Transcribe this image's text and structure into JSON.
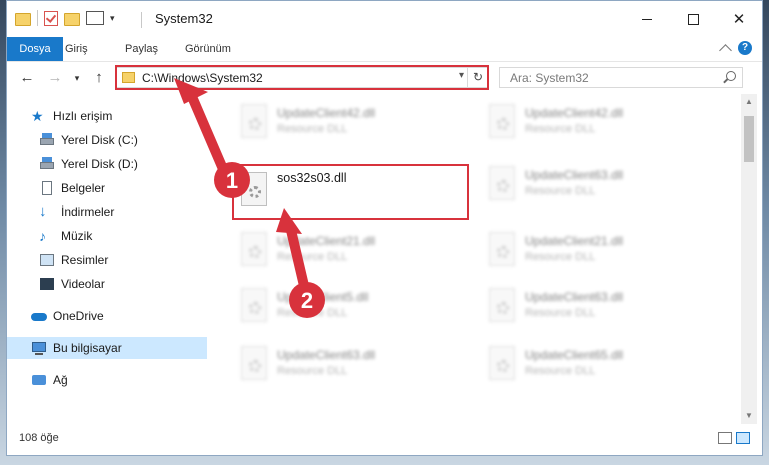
{
  "window": {
    "title": "System32",
    "controls": {
      "minimize": "minimize-icon",
      "maximize": "maximize-icon",
      "close": "✕"
    }
  },
  "ribbon": {
    "tabs": [
      "Dosya",
      "Giriş",
      "Paylaş",
      "Görünüm"
    ],
    "help": "?"
  },
  "nav": {
    "address": "C:\\Windows\\System32",
    "search_placeholder": "Ara: System32"
  },
  "sidebar": {
    "items": [
      {
        "label": "Hızlı erişim",
        "icon": "star-icon"
      },
      {
        "label": "Yerel Disk (C:)",
        "icon": "disk-icon",
        "pinned": true
      },
      {
        "label": "Yerel Disk (D:)",
        "icon": "disk-icon",
        "pinned": true
      },
      {
        "label": "Belgeler",
        "icon": "document-icon",
        "pinned": true
      },
      {
        "label": "İndirmeler",
        "icon": "download-icon",
        "pinned": true
      },
      {
        "label": "Müzik",
        "icon": "music-icon",
        "pinned": true
      },
      {
        "label": "Resimler",
        "icon": "pictures-icon",
        "pinned": true
      },
      {
        "label": "Videolar",
        "icon": "video-icon",
        "pinned": true
      },
      {
        "label": "OneDrive",
        "icon": "cloud-icon"
      },
      {
        "label": "Bu bilgisayar",
        "icon": "computer-icon",
        "selected": true
      },
      {
        "label": "Ağ",
        "icon": "network-icon"
      }
    ]
  },
  "files": {
    "left": [
      {
        "name": "UpdateClient42.dll",
        "type": "Resource DLL"
      },
      {
        "name": "sos32s03.dll",
        "type": ""
      },
      {
        "name": "UpdateClient21.dll",
        "type": "Resource DLL"
      },
      {
        "name": "UpdateClient5.dll",
        "type": "Resource DLL"
      },
      {
        "name": "UpdateClient63.dll",
        "type": "Resource DLL"
      }
    ],
    "right": [
      {
        "name": "UpdateClient42.dll",
        "type": "Resource DLL"
      },
      {
        "name": "UpdateClient63.dll",
        "type": "Resource DLL"
      },
      {
        "name": "UpdateClient21.dll",
        "type": "Resource DLL"
      },
      {
        "name": "UpdateClient63.dll",
        "type": "Resource DLL"
      },
      {
        "name": "UpdateClient65.dll",
        "type": "Resource DLL"
      }
    ]
  },
  "status": {
    "count": "108 öğe"
  },
  "annotations": {
    "step1": "1",
    "step2": "2",
    "accent": "#d8323c"
  }
}
